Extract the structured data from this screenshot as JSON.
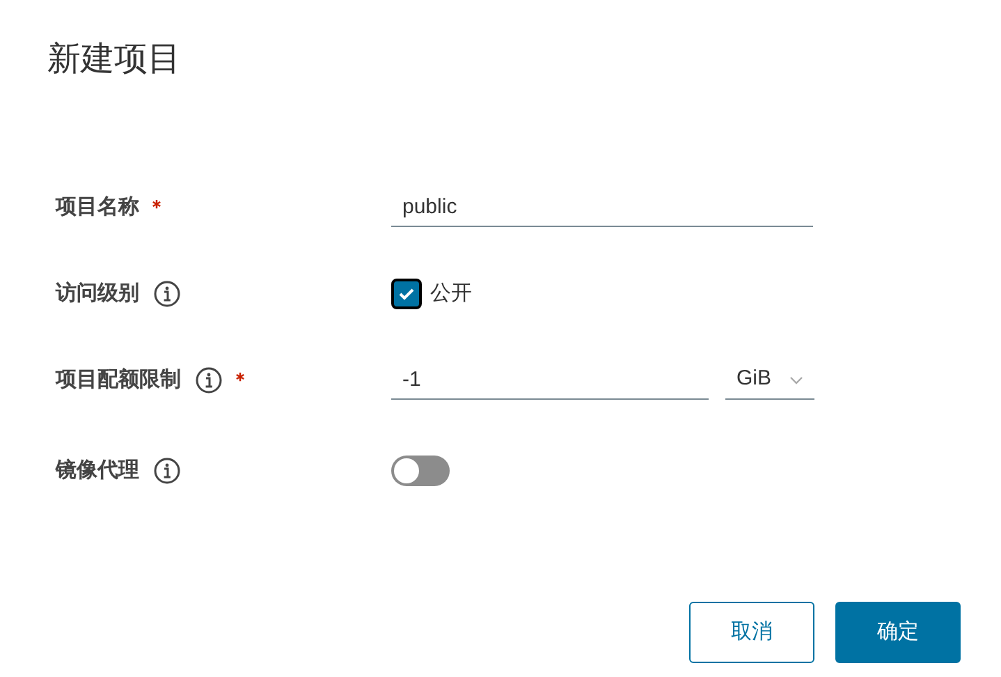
{
  "dialog": {
    "title": "新建项目"
  },
  "fields": [
    {
      "kind": "text",
      "label": "项目名称",
      "required": true,
      "info": false,
      "value": "public"
    },
    {
      "kind": "checkbox",
      "label": "访问级别",
      "required": false,
      "info": true,
      "checked": true,
      "option": "公开"
    },
    {
      "kind": "quota",
      "label": "项目配额限制",
      "required": true,
      "info": true,
      "value": "-1",
      "unit": "GiB"
    },
    {
      "kind": "toggle",
      "label": "镜像代理",
      "required": false,
      "info": true,
      "on": false
    }
  ],
  "buttons": [
    {
      "label": "取消",
      "kind": "secondary"
    },
    {
      "label": "确定",
      "kind": "primary"
    }
  ]
}
